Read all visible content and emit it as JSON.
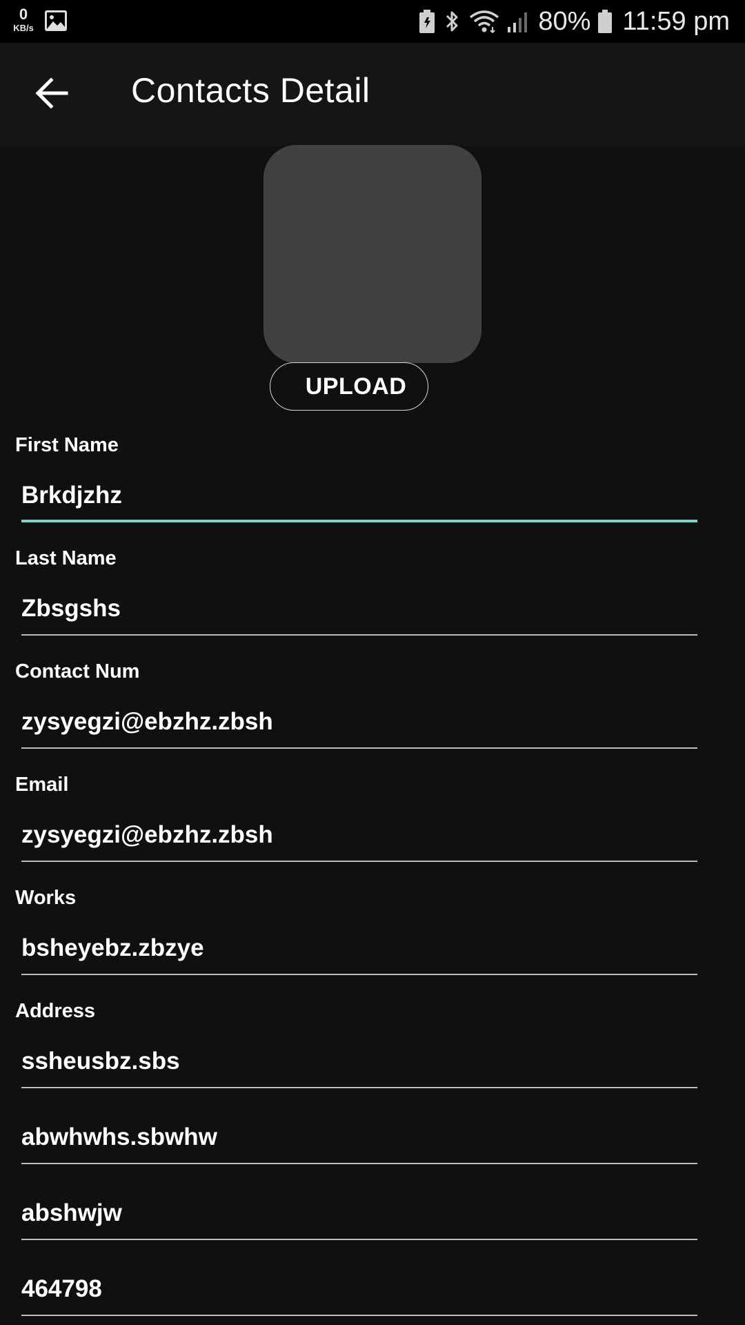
{
  "status_bar": {
    "net_speed_value": "0",
    "net_speed_unit": "KB/s",
    "battery_percent": "80%",
    "time": "11:59 pm",
    "icons": [
      "image-icon",
      "battery-saver-icon",
      "bluetooth-icon",
      "wifi-icon",
      "signal-icon",
      "battery-icon"
    ]
  },
  "app_bar": {
    "back_icon": "arrow-left-icon",
    "title": "Contacts Detail"
  },
  "avatar": {
    "upload_label": "UPLOAD"
  },
  "form": {
    "first_name": {
      "label": "First Name",
      "value": "Brkdjzhz"
    },
    "last_name": {
      "label": "Last Name",
      "value": "Zbsgshs"
    },
    "contact_num": {
      "label": "Contact Num",
      "value": "zysyegzi@ebzhz.zbsh"
    },
    "email": {
      "label": "Email",
      "value": "zysyegzi@ebzhz.zbsh"
    },
    "works": {
      "label": "Works",
      "value": "bsheyebz.zbzye"
    },
    "address": {
      "label": "Address",
      "line1": "ssheusbz.sbs",
      "line2": "abwhwhs.sbwhw",
      "line3": "abshwjw",
      "line4": "464798"
    }
  },
  "colors": {
    "background": "#101010",
    "focus_underline": "#7fd3c8",
    "avatar_placeholder": "#414141"
  }
}
